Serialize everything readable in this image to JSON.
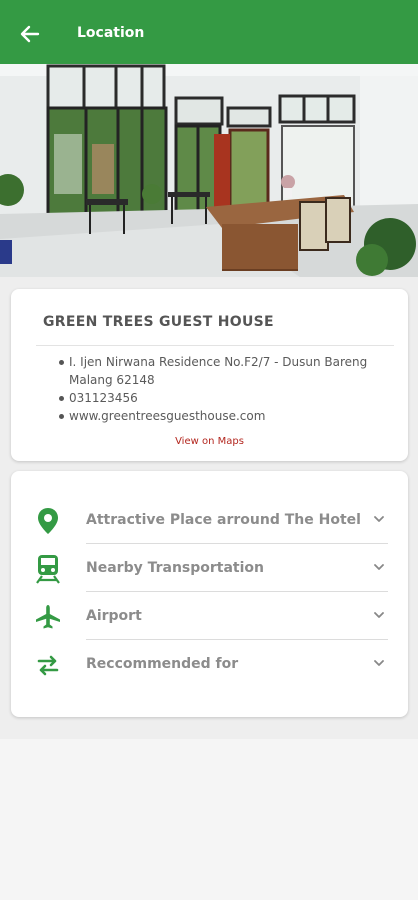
{
  "appbar": {
    "title": "Location"
  },
  "hotel": {
    "name": "GREEN TREES GUEST HOUSE",
    "address": "I. Ijen Nirwana Residence No.F2/7 - Dusun Bareng Malang 62148",
    "phone": "031123456",
    "website": "www.greentreesguesthouse.com",
    "maps_link": "View on Maps"
  },
  "sections": [
    {
      "label": "Attractive Place arround The Hotel",
      "icon": "location-pin-icon"
    },
    {
      "label": "Nearby Transportation",
      "icon": "train-icon"
    },
    {
      "label": "Airport",
      "icon": "airplane-icon"
    },
    {
      "label": "Reccommended for",
      "icon": "swap-arrows-icon"
    }
  ],
  "colors": {
    "brand_green": "#349a44",
    "link_red": "#b3261e",
    "label_gray": "#8c8c8c"
  }
}
